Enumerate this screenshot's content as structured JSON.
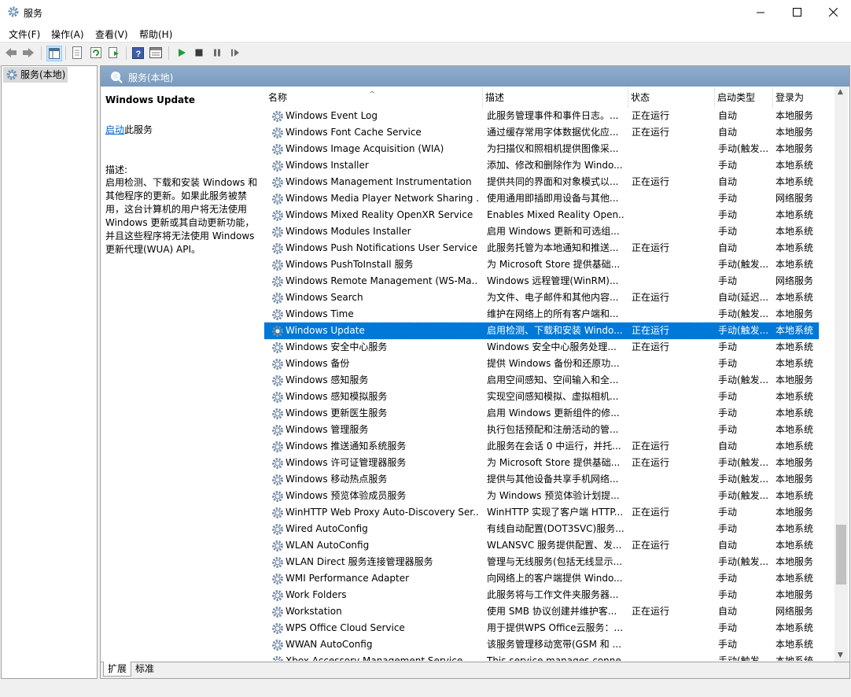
{
  "window": {
    "title": "服务",
    "minimize": "—",
    "maximize": "☐",
    "close": "✕"
  },
  "menu": [
    "文件(F)",
    "操作(A)",
    "查看(V)",
    "帮助(H)"
  ],
  "toolbar": {
    "icons": [
      "back-icon",
      "forward-icon",
      "show-hide-console-tree-icon",
      "properties-icon",
      "refresh-icon",
      "export-list-icon",
      "help-icon",
      "view-icon",
      "start-service-icon",
      "stop-service-icon",
      "pause-service-icon",
      "resume-service-icon"
    ]
  },
  "tree": {
    "node": "服务(本地)"
  },
  "header": {
    "title": "服务(本地)"
  },
  "description": {
    "service_name": "Windows Update",
    "start_link": "启动",
    "start_suffix": "此服务",
    "label": "描述:",
    "text": "启用检测、下载和安装 Windows 和其他程序的更新。如果此服务被禁用，这台计算机的用户将无法使用 Windows 更新或其自动更新功能，并且这些程序将无法使用 Windows 更新代理(WUA) API。"
  },
  "columns": {
    "name": "名称",
    "desc": "描述",
    "status": "状态",
    "startup": "启动类型",
    "logon": "登录为"
  },
  "rows": [
    {
      "name": "Windows Event Log",
      "desc": "此服务管理事件和事件日志。...",
      "status": "正在运行",
      "startup": "自动",
      "logon": "本地服务"
    },
    {
      "name": "Windows Font Cache Service",
      "desc": "通过缓存常用字体数据优化应...",
      "status": "正在运行",
      "startup": "自动",
      "logon": "本地服务"
    },
    {
      "name": "Windows Image Acquisition (WIA)",
      "desc": "为扫描仪和照相机提供图像采...",
      "status": "",
      "startup": "手动(触发...",
      "logon": "本地服务"
    },
    {
      "name": "Windows Installer",
      "desc": "添加、修改和删除作为 Windo...",
      "status": "",
      "startup": "手动",
      "logon": "本地系统"
    },
    {
      "name": "Windows Management Instrumentation",
      "desc": "提供共同的界面和对象模式以...",
      "status": "正在运行",
      "startup": "自动",
      "logon": "本地系统"
    },
    {
      "name": "Windows Media Player Network Sharing ...",
      "desc": "使用通用即插即用设备与其他...",
      "status": "",
      "startup": "手动",
      "logon": "网络服务"
    },
    {
      "name": "Windows Mixed Reality OpenXR Service",
      "desc": "Enables Mixed Reality Open...",
      "status": "",
      "startup": "手动",
      "logon": "本地系统"
    },
    {
      "name": "Windows Modules Installer",
      "desc": "启用 Windows 更新和可选组...",
      "status": "",
      "startup": "手动",
      "logon": "本地系统"
    },
    {
      "name": "Windows Push Notifications User Service...",
      "desc": "此服务托管为本地通知和推送...",
      "status": "正在运行",
      "startup": "自动",
      "logon": "本地系统"
    },
    {
      "name": "Windows PushToInstall 服务",
      "desc": "为 Microsoft Store 提供基础...",
      "status": "",
      "startup": "手动(触发...",
      "logon": "本地系统"
    },
    {
      "name": "Windows Remote Management (WS-Ma...",
      "desc": "Windows 远程管理(WinRM)...",
      "status": "",
      "startup": "手动",
      "logon": "网络服务"
    },
    {
      "name": "Windows Search",
      "desc": "为文件、电子邮件和其他内容...",
      "status": "正在运行",
      "startup": "自动(延迟...",
      "logon": "本地系统"
    },
    {
      "name": "Windows Time",
      "desc": "维护在网络上的所有客户端和...",
      "status": "",
      "startup": "手动(触发...",
      "logon": "本地服务"
    },
    {
      "name": "Windows Update",
      "desc": "启用检测、下载和安装 Windo...",
      "status": "正在运行",
      "startup": "手动(触发...",
      "logon": "本地系统",
      "selected": true
    },
    {
      "name": "Windows 安全中心服务",
      "desc": "Windows 安全中心服务处理...",
      "status": "正在运行",
      "startup": "手动",
      "logon": "本地系统"
    },
    {
      "name": "Windows 备份",
      "desc": "提供 Windows 备份和还原功...",
      "status": "",
      "startup": "手动",
      "logon": "本地系统"
    },
    {
      "name": "Windows 感知服务",
      "desc": "启用空间感知、空间输入和全...",
      "status": "",
      "startup": "手动(触发...",
      "logon": "本地服务"
    },
    {
      "name": "Windows 感知模拟服务",
      "desc": "实现空间感知模拟、虚拟相机...",
      "status": "",
      "startup": "手动",
      "logon": "本地系统"
    },
    {
      "name": "Windows 更新医生服务",
      "desc": "启用 Windows 更新组件的修...",
      "status": "",
      "startup": "手动",
      "logon": "本地系统"
    },
    {
      "name": "Windows 管理服务",
      "desc": "执行包括预配和注册活动的管...",
      "status": "",
      "startup": "手动",
      "logon": "本地系统"
    },
    {
      "name": "Windows 推送通知系统服务",
      "desc": "此服务在会话 0 中运行，并托...",
      "status": "正在运行",
      "startup": "自动",
      "logon": "本地系统"
    },
    {
      "name": "Windows 许可证管理器服务",
      "desc": "为 Microsoft Store 提供基础...",
      "status": "正在运行",
      "startup": "手动(触发...",
      "logon": "本地服务"
    },
    {
      "name": "Windows 移动热点服务",
      "desc": "提供与其他设备共享手机网络...",
      "status": "",
      "startup": "手动(触发...",
      "logon": "本地服务"
    },
    {
      "name": "Windows 预览体验成员服务",
      "desc": "为 Windows 预览体验计划提...",
      "status": "",
      "startup": "手动(触发...",
      "logon": "本地系统"
    },
    {
      "name": "WinHTTP Web Proxy Auto-Discovery Ser...",
      "desc": "WinHTTP 实现了客户端 HTTP...",
      "status": "正在运行",
      "startup": "手动",
      "logon": "本地服务"
    },
    {
      "name": "Wired AutoConfig",
      "desc": "有线自动配置(DOT3SVC)服务...",
      "status": "",
      "startup": "手动",
      "logon": "本地系统"
    },
    {
      "name": "WLAN AutoConfig",
      "desc": "WLANSVC 服务提供配置、发...",
      "status": "正在运行",
      "startup": "自动",
      "logon": "本地系统"
    },
    {
      "name": "WLAN Direct 服务连接管理器服务",
      "desc": "管理与无线服务(包括无线显示...",
      "status": "",
      "startup": "手动(触发...",
      "logon": "本地服务"
    },
    {
      "name": "WMI Performance Adapter",
      "desc": "向网络上的客户端提供 Windo...",
      "status": "",
      "startup": "手动",
      "logon": "本地系统"
    },
    {
      "name": "Work Folders",
      "desc": "此服务将与工作文件夹服务器...",
      "status": "",
      "startup": "手动",
      "logon": "本地服务"
    },
    {
      "name": "Workstation",
      "desc": "使用 SMB 协议创建并维护客...",
      "status": "正在运行",
      "startup": "自动",
      "logon": "网络服务"
    },
    {
      "name": "WPS Office Cloud Service",
      "desc": "用于提供WPS Office云服务：...",
      "status": "",
      "startup": "手动",
      "logon": "本地系统"
    },
    {
      "name": "WWAN AutoConfig",
      "desc": "该服务管理移动宽带(GSM 和 ...",
      "status": "",
      "startup": "手动",
      "logon": "本地系统"
    },
    {
      "name": "Xbox Accessory Management Service",
      "desc": "This service manages conne...",
      "status": "",
      "startup": "手动(触发...",
      "logon": "本地系统"
    }
  ],
  "tabs": [
    "扩展",
    "标准"
  ],
  "colors": {
    "selection": "#0078d7",
    "header_band": "#7a9bbf",
    "link": "#0066cc"
  }
}
